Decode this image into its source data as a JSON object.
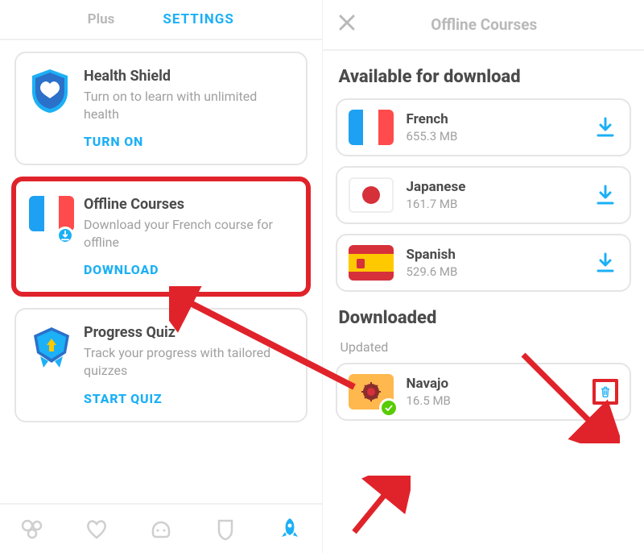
{
  "left": {
    "tabs": {
      "plus": "Plus",
      "settings": "SETTINGS"
    },
    "health": {
      "title": "Health Shield",
      "desc": "Turn on to learn with unlimited health",
      "action": "TURN ON"
    },
    "offline": {
      "title": "Offline Courses",
      "desc": "Download your French course for offline",
      "action": "DOWNLOAD"
    },
    "quiz": {
      "title": "Progress Quiz",
      "desc": "Track your progress with tailored quizzes",
      "action": "START QUIZ"
    }
  },
  "right": {
    "header": "Offline Courses",
    "availableHeader": "Available for download",
    "available": [
      {
        "name": "French",
        "size": "655.3 MB"
      },
      {
        "name": "Japanese",
        "size": "161.7 MB"
      },
      {
        "name": "Spanish",
        "size": "529.6 MB"
      }
    ],
    "downloadedHeader": "Downloaded",
    "downloadedSub": "Updated",
    "downloaded": [
      {
        "name": "Navajo",
        "size": "16.5 MB"
      }
    ]
  }
}
